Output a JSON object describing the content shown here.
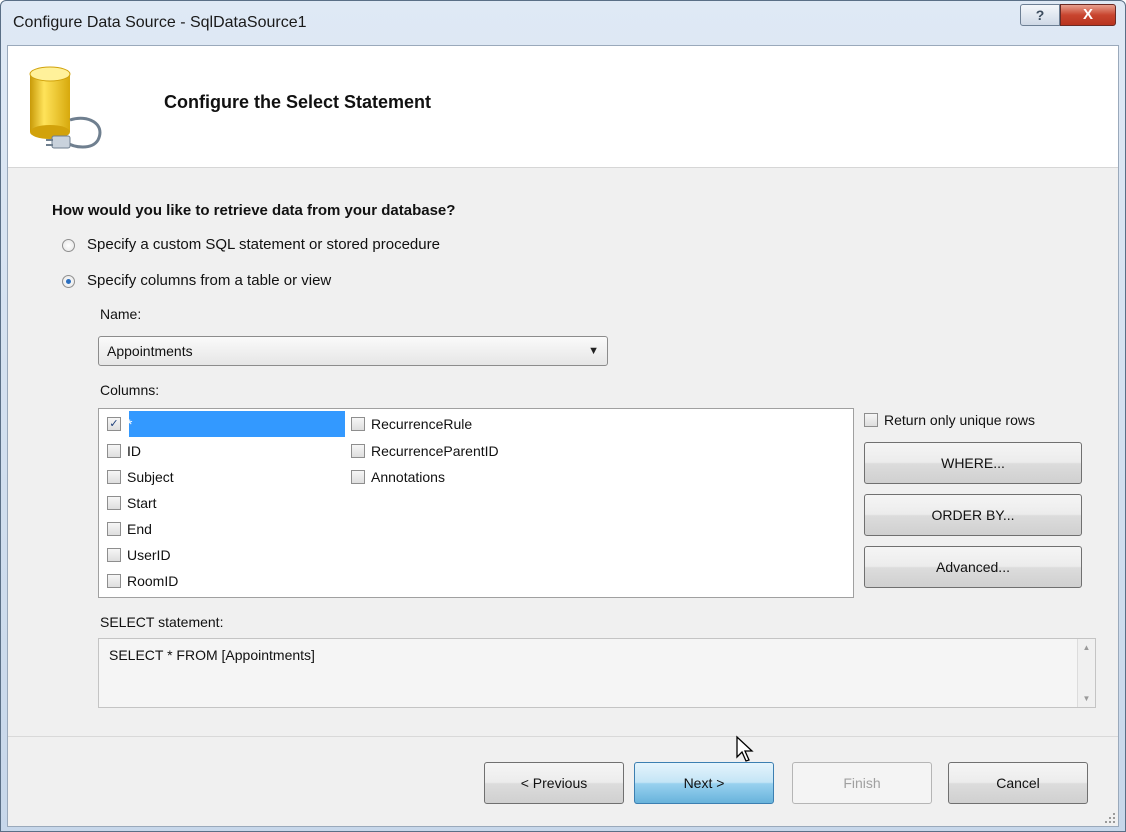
{
  "window": {
    "title": "Configure Data Source - SqlDataSource1",
    "help_glyph": "?",
    "close_glyph": "X"
  },
  "header": {
    "title": "Configure the Select Statement",
    "icon": "database-plug-icon"
  },
  "question": "How would you like to retrieve data from your database?",
  "options": [
    {
      "label": "Specify a custom SQL statement or stored procedure",
      "selected": false
    },
    {
      "label": "Specify columns from a table or view",
      "selected": true
    }
  ],
  "name_label": "Name:",
  "name_value": "Appointments",
  "columns_label": "Columns:",
  "columns": [
    {
      "label": "*",
      "checked": true,
      "selected": true
    },
    {
      "label": "ID",
      "checked": false
    },
    {
      "label": "Subject",
      "checked": false
    },
    {
      "label": "Start",
      "checked": false
    },
    {
      "label": "End",
      "checked": false
    },
    {
      "label": "UserID",
      "checked": false
    },
    {
      "label": "RoomID",
      "checked": false
    },
    {
      "label": "RecurrenceRule",
      "checked": false
    },
    {
      "label": "RecurrenceParentID",
      "checked": false
    },
    {
      "label": "Annotations",
      "checked": false
    }
  ],
  "unique_rows_label": "Return only unique rows",
  "where_label": "WHERE...",
  "orderby_label": "ORDER BY...",
  "advanced_label": "Advanced...",
  "select_statement_label": "SELECT statement:",
  "select_statement": "SELECT * FROM [Appointments]",
  "buttons": {
    "previous": "< Previous",
    "next": "Next >",
    "finish": "Finish",
    "cancel": "Cancel"
  },
  "colors": {
    "selection": "#3399ff",
    "primary_button": "#c4e5f6",
    "close_button": "#c8452f"
  }
}
